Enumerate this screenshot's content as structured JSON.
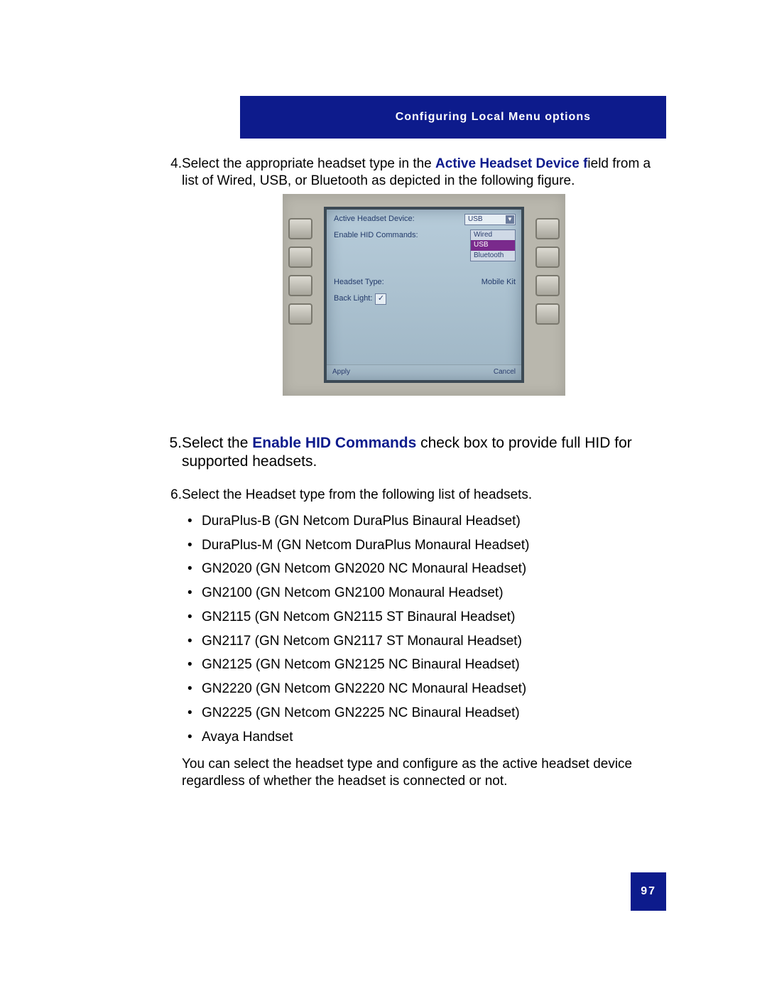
{
  "header": {
    "title": "Configuring Local Menu options"
  },
  "step4": {
    "num": "4.",
    "pre": "Select the appropriate headset type in the ",
    "bold": "Active Headset Device f",
    "post": "ield from a list of Wired, USB, or Bluetooth as depicted in the following figure."
  },
  "device_screen": {
    "row1_label": "Active Headset Device:",
    "row1_value": "USB",
    "row2_label": "Enable HID Commands:",
    "dropdown": {
      "opt0": "Wired",
      "opt1_sel": "USB",
      "opt2": "Bluetooth"
    },
    "row3_label": "Headset Type:",
    "row3_value": "Mobile Kit",
    "row4_label": "Back Light:",
    "checkbox_mark": "✓",
    "softkey_left": "Apply",
    "softkey_right": "Cancel"
  },
  "step5": {
    "num": "5.",
    "pre": "Select the ",
    "bold": "Enable HID Commands",
    "post": " check box to provide full HID for supported headsets."
  },
  "step6": {
    "num": "6.",
    "text": "Select the Headset type from the following list of headsets.",
    "items": [
      "DuraPlus-B (GN Netcom DuraPlus Binaural Headset)",
      "DuraPlus-M (GN Netcom DuraPlus Monaural Headset)",
      "GN2020 (GN Netcom GN2020 NC Monaural Headset)",
      "GN2100 (GN Netcom GN2100 Monaural Headset)",
      "GN2115 (GN Netcom GN2115 ST Binaural Headset)",
      "GN2117 (GN Netcom GN2117 ST Monaural Headset)",
      "GN2125 (GN Netcom GN2125 NC Binaural Headset)",
      "GN2220 (GN Netcom GN2220 NC Monaural Headset)",
      "GN2225 (GN Netcom GN2225 NC Binaural Headset)",
      "Avaya Handset"
    ],
    "closing": "You can select the headset type and configure as the active headset device regardless of whether the headset is connected or not."
  },
  "page_number": "97"
}
